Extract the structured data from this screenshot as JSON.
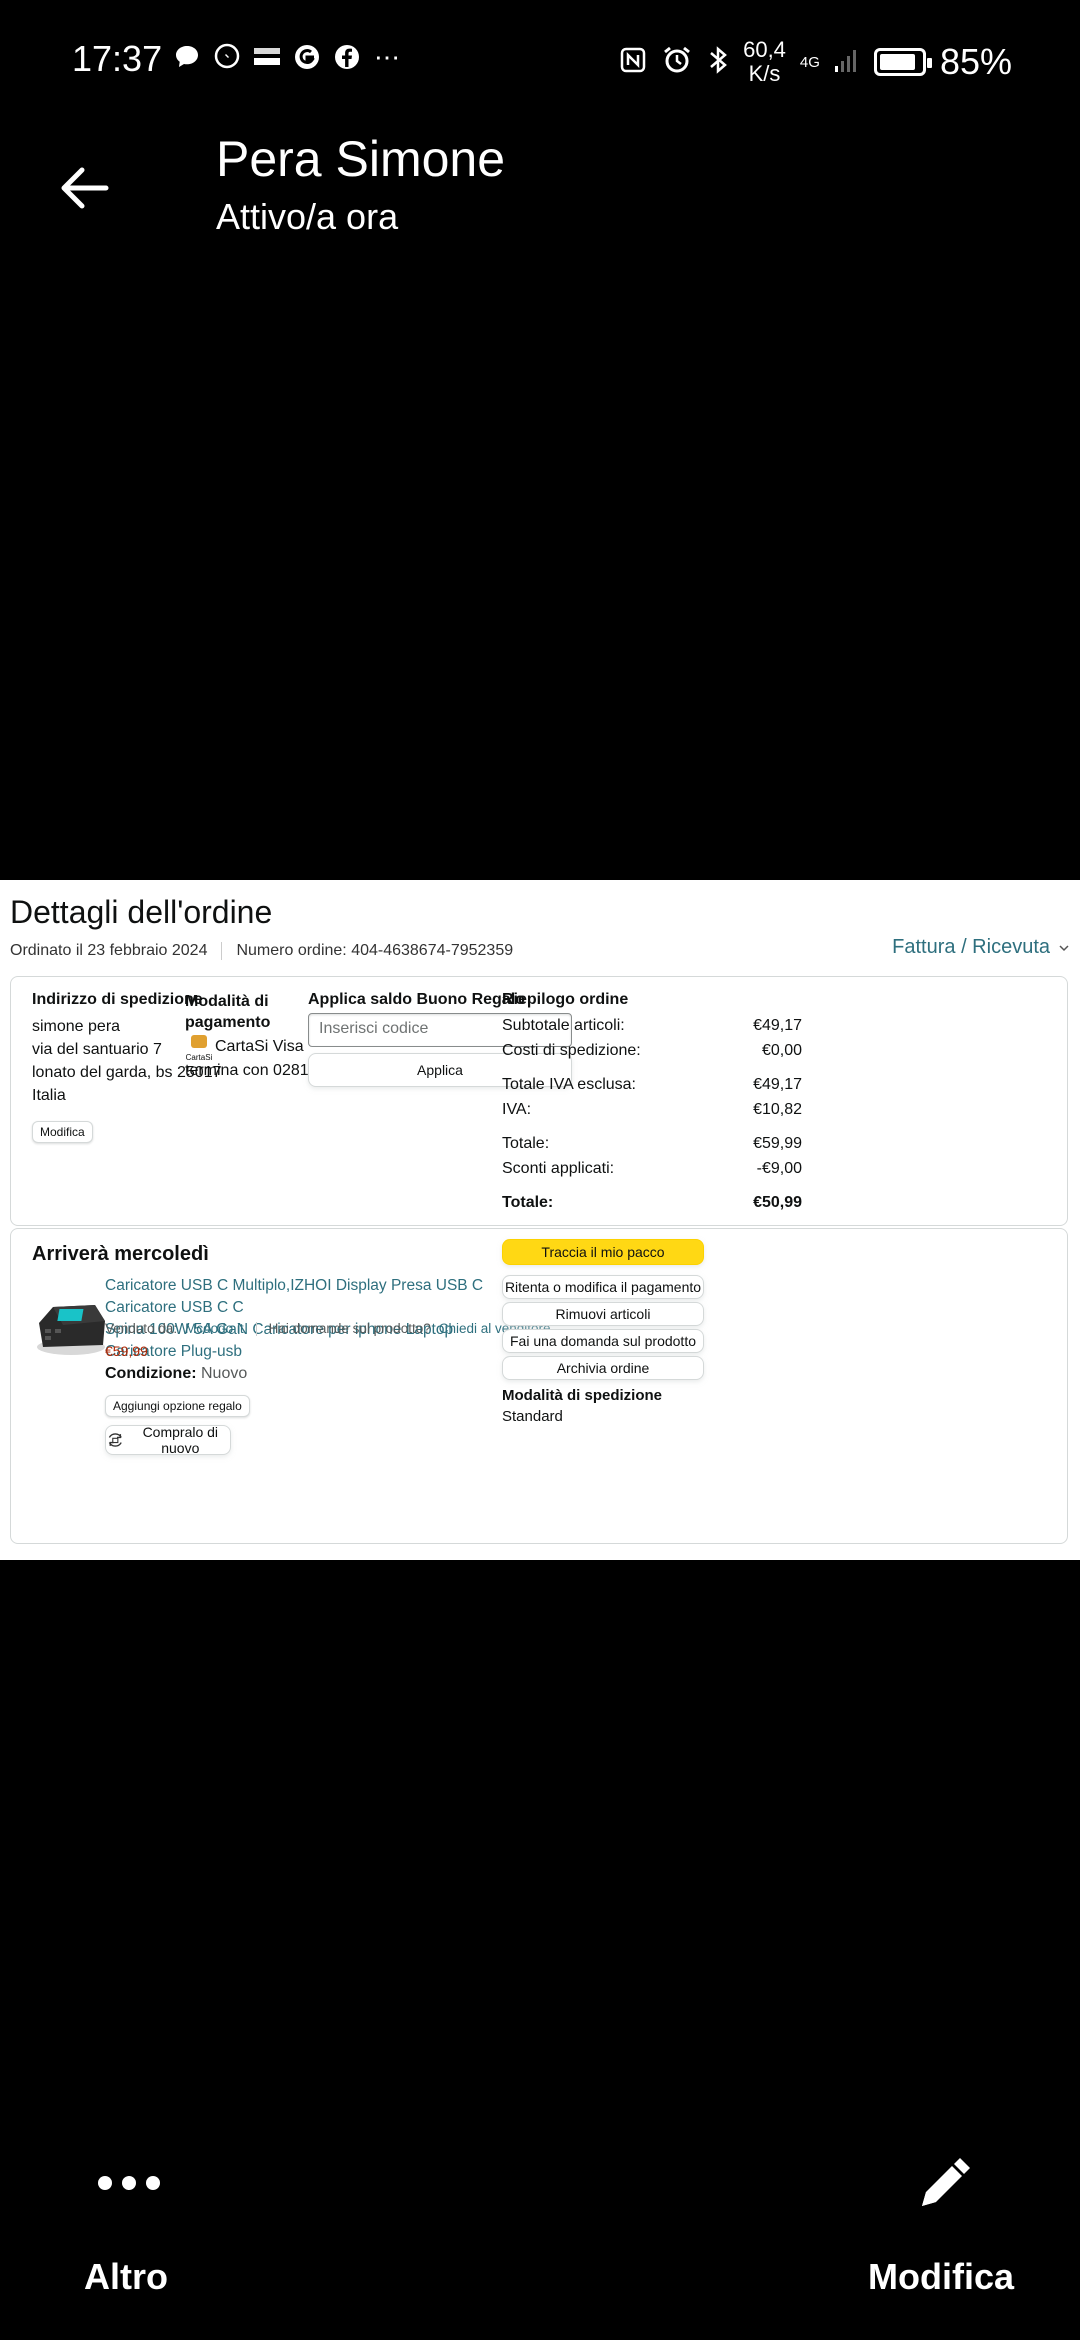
{
  "status_bar": {
    "time": "17:37",
    "network_speed": "60,4",
    "network_unit": "K/s",
    "network_type": "4G",
    "battery": "85%"
  },
  "header": {
    "contact_name": "Pera Simone",
    "status": "Attivo/a ora"
  },
  "order": {
    "title": "Dettagli dell'ordine",
    "ordered_on": "Ordinato il 23 febbraio 2024",
    "order_number": "Numero ordine: 404-4638674-7952359",
    "invoice_link": "Fattura / Ricevuta",
    "shipping": {
      "label": "Indirizzo di spedizione",
      "lines": [
        "simone pera",
        "via del santuario 7",
        "lonato del garda, bs 25017",
        "Italia"
      ],
      "edit_button": "Modifica"
    },
    "payment": {
      "label_line1": "Modalità di",
      "label_line2": "pagamento",
      "card_logo": "CartaSi",
      "card_name": "CartaSi Visa",
      "card_ending": "termina con 0281"
    },
    "gift": {
      "label": "Applica saldo Buono Regalo",
      "placeholder": "Inserisci codice",
      "apply_button": "Applica"
    },
    "summary": {
      "label": "Riepilogo ordine",
      "rows": [
        {
          "label": "Subtotale articoli:",
          "value": "€49,17"
        },
        {
          "label": "Costi di spedizione:",
          "value": "€0,00"
        },
        {
          "label": "Totale IVA esclusa:",
          "value": "€49,17"
        },
        {
          "label": "IVA:",
          "value": "€10,82"
        },
        {
          "label": "Totale:",
          "value": "€59,99"
        },
        {
          "label": "Sconti applicati:",
          "value": "-€9,00"
        },
        {
          "label": "Totale:",
          "value": "€50,99"
        }
      ]
    },
    "delivery": {
      "heading": "Arriverà mercoledì",
      "product_title_line1": "Caricatore USB C Multiplo,IZHOI Display Presa USB C Caricatore USB C C",
      "product_title_line2": "Spina 100W 5A GaN Caricatore per iphone Laptop Caricatore Plug-usb",
      "sold_by_label": "Venduto da:",
      "seller": "Mcdodo it",
      "question_text": "Hai domande sul prodotto?",
      "ask_seller": "Chiedi al venditore",
      "price": "€59,99",
      "condition_label": "Condizione:",
      "condition_value": "Nuovo",
      "gift_option": "Aggiungi opzione regalo",
      "buy_again": "Compralo di nuovo",
      "actions": {
        "track": "Traccia il mio pacco",
        "retry_payment": "Ritenta o modifica il pagamento",
        "remove_items": "Rimuovi articoli",
        "ask_question": "Fai una domanda sul prodotto",
        "archive": "Archivia ordine"
      },
      "shipping_mode_label": "Modalità di spedizione",
      "shipping_mode_value": "Standard"
    }
  },
  "bottom_bar": {
    "more_label": "Altro",
    "edit_label": "Modifica"
  }
}
